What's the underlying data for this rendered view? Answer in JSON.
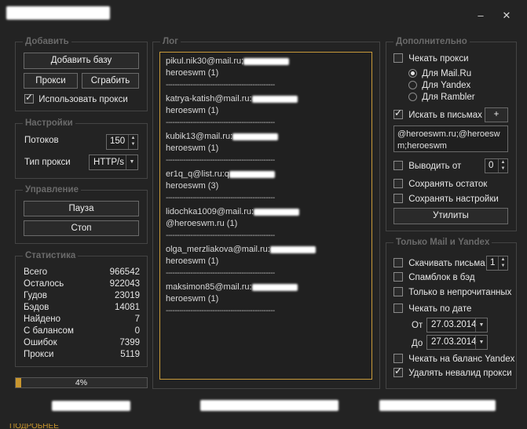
{
  "window": {
    "title": "",
    "min": "–",
    "close": "✕"
  },
  "groups": {
    "add": "Добавить",
    "settings": "Настройки",
    "control": "Управление",
    "stats": "Статистика",
    "log": "Лог",
    "extra": "Дополнительно",
    "mail_yandex": "Только Mail и Yandex"
  },
  "add": {
    "add_base": "Добавить базу",
    "proxy": "Прокси",
    "grab": "Сграбить",
    "use_proxy": "Использовать прокси",
    "use_proxy_checked": true
  },
  "settings": {
    "threads_label": "Потоков",
    "threads_value": "150",
    "proxy_type_label": "Тип прокси",
    "proxy_type_value": "HTTP/s"
  },
  "control": {
    "pause": "Пауза",
    "stop": "Стоп"
  },
  "stats": [
    {
      "name": "Всего",
      "value": "966542"
    },
    {
      "name": "Осталось",
      "value": "922043"
    },
    {
      "name": "Гудов",
      "value": "23019"
    },
    {
      "name": "Бэдов",
      "value": "14081"
    },
    {
      "name": "Найдено",
      "value": "7"
    },
    {
      "name": "С балансом",
      "value": "0"
    },
    {
      "name": "Ошибок",
      "value": "7399"
    },
    {
      "name": "Прокси",
      "value": "5119"
    }
  ],
  "progress": {
    "percent": 4,
    "label": "4%"
  },
  "log": {
    "separator": "-------------------------------------------------",
    "entries": [
      {
        "email": "pikul.nik30@mail.ru;",
        "lines": [
          "heroeswm (1)"
        ]
      },
      {
        "email": "katrya-katish@mail.ru:",
        "lines": [
          "heroeswm (1)"
        ]
      },
      {
        "email": "kubik13@mail.ru:",
        "lines": [
          "heroeswm (1)"
        ]
      },
      {
        "email": "er1q_q@list.ru:q",
        "lines": [
          "heroeswm (3)"
        ]
      },
      {
        "email": "lidochka1009@mail.ru:",
        "lines": [
          "@heroeswm.ru (1)"
        ]
      },
      {
        "email": "olga_merzliakova@mail.ru:",
        "lines": [
          "heroeswm (1)"
        ]
      },
      {
        "email": "maksimon85@mail.ru:",
        "lines": [
          "heroeswm (1)"
        ]
      }
    ]
  },
  "extra": {
    "check_proxy": "Чекать прокси",
    "check_proxy_checked": false,
    "radio_options": [
      "Для Mail.Ru",
      "Для Yandex",
      "Для Rambler"
    ],
    "radio_selected": 0,
    "search_letters": "Искать в письмах",
    "search_letters_checked": true,
    "plus": "+",
    "search_terms": "@heroeswm.ru;@heroeswm;heroeswm",
    "output_from": "Выводить от",
    "output_from_value": "0",
    "save_rest": "Сохранять остаток",
    "save_settings": "Сохранять настройки",
    "utilities": "Утилиты"
  },
  "mail_yandex": {
    "download_letters": "Скачивать письма",
    "download_letters_value": "1",
    "spamblock": "Спамблок в бэд",
    "unread_only": "Только в непрочитанных",
    "check_by_date": "Чекать по дате",
    "from_label": "От",
    "from_date": "27.03.2014",
    "to_label": "До",
    "to_date": "27.03.2014",
    "check_balance_yandex": "Чекать на баланс Yandex",
    "delete_invalid_proxy": "Удалять невалид прокси",
    "delete_invalid_proxy_checked": true
  },
  "footer": {
    "link": "ПОДРОБНЕЕ"
  }
}
